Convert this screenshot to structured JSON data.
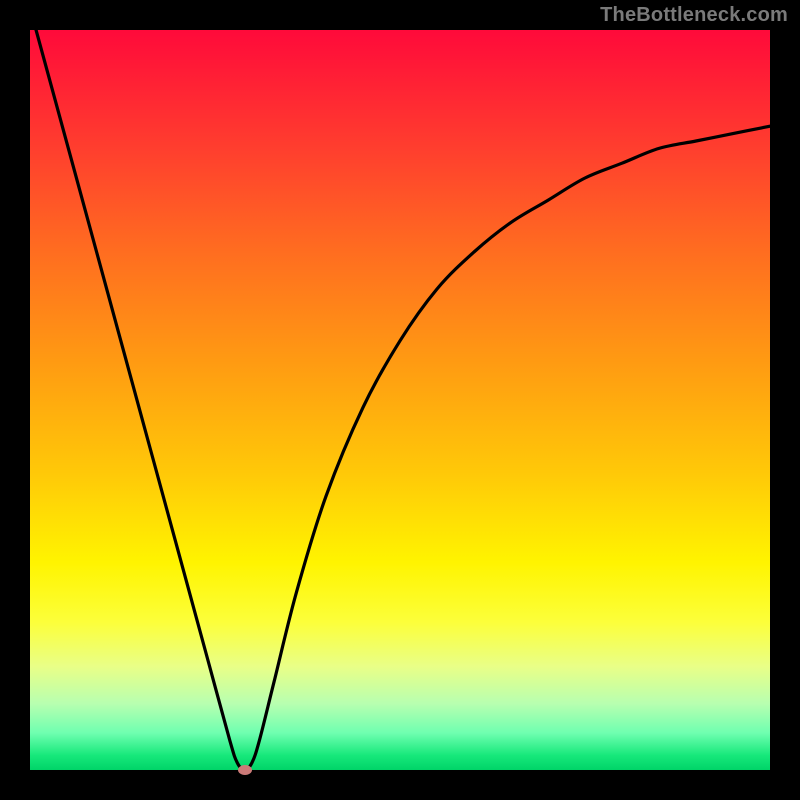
{
  "watermark": "TheBottleneck.com",
  "chart_data": {
    "type": "line",
    "title": "",
    "xlabel": "",
    "ylabel": "",
    "xlim": [
      0,
      100
    ],
    "ylim": [
      0,
      100
    ],
    "grid": false,
    "legend": false,
    "series": [
      {
        "name": "curve",
        "x": [
          0,
          3,
          6,
          9,
          12,
          15,
          18,
          21,
          24,
          27,
          28,
          29,
          30,
          31,
          33,
          36,
          40,
          45,
          50,
          55,
          60,
          65,
          70,
          75,
          80,
          85,
          90,
          95,
          100
        ],
        "y": [
          103,
          92,
          81,
          70,
          59,
          48,
          37,
          26,
          15,
          4,
          1,
          0,
          1,
          4,
          12,
          24,
          37,
          49,
          58,
          65,
          70,
          74,
          77,
          80,
          82,
          84,
          85,
          86,
          87
        ]
      }
    ],
    "marker": {
      "x": 29,
      "y": 0,
      "color": "#cc7a78"
    },
    "background_gradient": {
      "top": "#ff0a3a",
      "mid": "#fff400",
      "bottom": "#00d468"
    }
  },
  "colors": {
    "frame_background": "#000000",
    "curve_stroke": "#000000",
    "watermark": "#7a7a7a"
  }
}
